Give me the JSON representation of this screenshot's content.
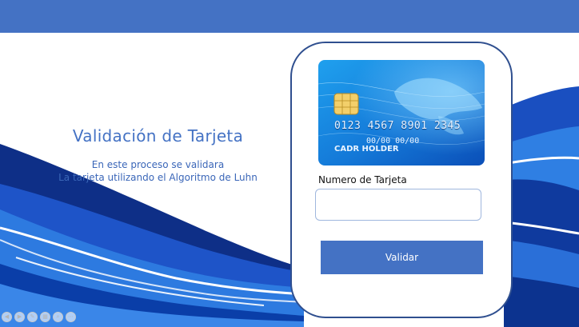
{
  "intro": {
    "title": "Validación de Tarjeta",
    "line1": "En este proceso se validara",
    "line2": "La tarjeta utilizando el Algoritmo de Luhn"
  },
  "card": {
    "number": "0123 4567 8901 2345",
    "dates": "00/00  00/00",
    "holder": "CADR HOLDER"
  },
  "form": {
    "label": "Numero de Tarjeta",
    "value": "",
    "placeholder": "",
    "button_label": "Validar"
  },
  "colors": {
    "accent": "#4472c4",
    "panel_border": "#2f4f8f"
  }
}
